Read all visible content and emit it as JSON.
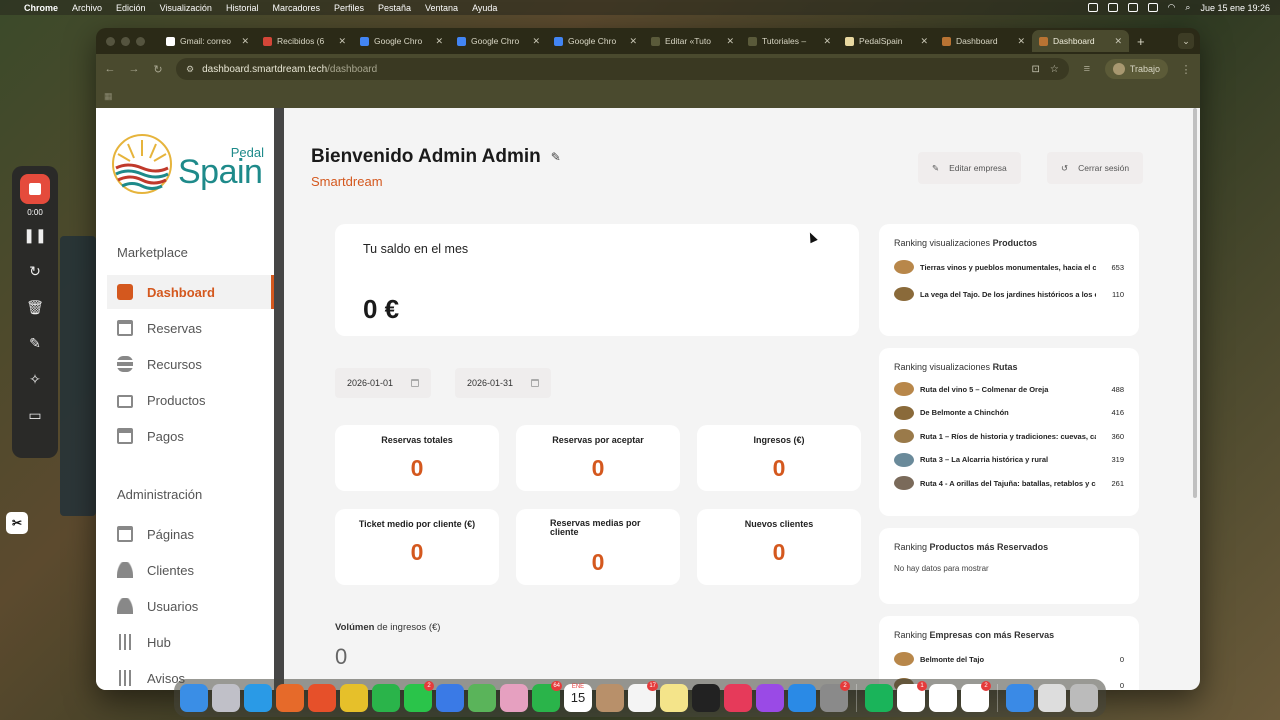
{
  "menubar": {
    "app": "Chrome",
    "items": [
      "Archivo",
      "Edición",
      "Visualización",
      "Historial",
      "Marcadores",
      "Perfiles",
      "Pestaña",
      "Ventana",
      "Ayuda"
    ],
    "clock": "Jue 15 ene 19:26"
  },
  "browser": {
    "tabs": [
      {
        "label": "Gmail: correo",
        "color": "#ffffff"
      },
      {
        "label": "Recibidos (6",
        "color": "#d44638"
      },
      {
        "label": "Google Chro",
        "color": "#4285f4"
      },
      {
        "label": "Google Chro",
        "color": "#4285f4"
      },
      {
        "label": "Google Chro",
        "color": "#4285f4"
      },
      {
        "label": "Editar «Tuto",
        "color": "#5a5a3a"
      },
      {
        "label": "Tutoriales –",
        "color": "#5a5a3a"
      },
      {
        "label": "PedalSpain",
        "color": "#e8d8a0"
      },
      {
        "label": "Dashboard",
        "color": "#b87333"
      },
      {
        "label": "Dashboard",
        "color": "#b87333"
      }
    ],
    "url_domain": "dashboard.smartdream.tech",
    "url_path": "/dashboard",
    "profile_label": "Trabajo"
  },
  "recorder": {
    "time": "0:00"
  },
  "sidebar": {
    "logo_small": "Pedal",
    "logo_large": "Spain",
    "section1": "Marketplace",
    "marketplace_items": [
      {
        "label": "Dashboard",
        "icon": "dashboard-icon"
      },
      {
        "label": "Reservas",
        "icon": "calendar-icon"
      },
      {
        "label": "Recursos",
        "icon": "database-icon"
      },
      {
        "label": "Productos",
        "icon": "briefcase-icon"
      },
      {
        "label": "Pagos",
        "icon": "credit-card-icon"
      }
    ],
    "section2": "Administración",
    "admin_items": [
      {
        "label": "Páginas",
        "icon": "page-icon"
      },
      {
        "label": "Clientes",
        "icon": "user-icon"
      },
      {
        "label": "Usuarios",
        "icon": "user-icon"
      },
      {
        "label": "Hub",
        "icon": "sliders-icon"
      },
      {
        "label": "Avisos",
        "icon": "sliders-icon"
      }
    ]
  },
  "header": {
    "welcome": "Bienvenido Admin Admin",
    "company": "Smartdream",
    "edit_company": "Editar empresa",
    "logout": "Cerrar sesión"
  },
  "balance": {
    "title": "Tu saldo en el mes",
    "value": "0 €"
  },
  "dates": {
    "from": "2026-01-01",
    "to": "2026-01-31"
  },
  "stats": [
    {
      "label": "Reservas totales",
      "value": "0"
    },
    {
      "label": "Reservas por aceptar",
      "value": "0"
    },
    {
      "label": "Ingresos (€)",
      "value": "0"
    },
    {
      "label": "Ticket medio por cliente (€)",
      "value": "0"
    },
    {
      "label": "Reservas medias por cliente",
      "value": "0"
    },
    {
      "label": "Nuevos clientes",
      "value": "0"
    }
  ],
  "volume": {
    "label_bold": "Volúmen",
    "label_rest": " de ingresos (€)",
    "value": "0"
  },
  "rankings": {
    "products": {
      "prefix": "Ranking visualizaciones ",
      "bold": "Productos",
      "rows": [
        {
          "name": "Tierras vinos y pueblos monumentales, hacia el ca...",
          "count": "653"
        },
        {
          "name": "La vega del Tajo. De los jardines históricos a los ca...",
          "count": "110"
        }
      ]
    },
    "routes": {
      "prefix": "Ranking visualizaciones ",
      "bold": "Rutas",
      "rows": [
        {
          "name": "Ruta del vino 5 – Colmenar de Oreja",
          "count": "488"
        },
        {
          "name": "De Belmonte a Chinchón",
          "count": "416"
        },
        {
          "name": "Ruta 1 – Ríos de historia y tradiciones: cuevas, ca...",
          "count": "360"
        },
        {
          "name": "Ruta 3 – La Alcarria histórica y rural",
          "count": "319"
        },
        {
          "name": "Ruta 4 - A orillas del Tajuña: batallas, retablos y ca...",
          "count": "261"
        }
      ]
    },
    "reserved": {
      "prefix": "Ranking ",
      "bold": "Productos más Reservados",
      "empty": "No hay datos para mostrar"
    },
    "companies": {
      "prefix": "Ranking ",
      "bold": "Empresas con más Reservas",
      "rows": [
        {
          "name": "Belmonte del Tajo",
          "count": "0"
        },
        {
          "name": "",
          "count": "0"
        }
      ]
    }
  },
  "dock": {
    "calendar_month": "ENE",
    "calendar_day": "15",
    "badges": {
      "messages": "2",
      "facetime": "64",
      "reminders": "17",
      "notion": "1",
      "slack": "2",
      "settings": "2"
    }
  },
  "colors": {
    "accent": "#d4581e",
    "brand": "#1e8a8a"
  }
}
